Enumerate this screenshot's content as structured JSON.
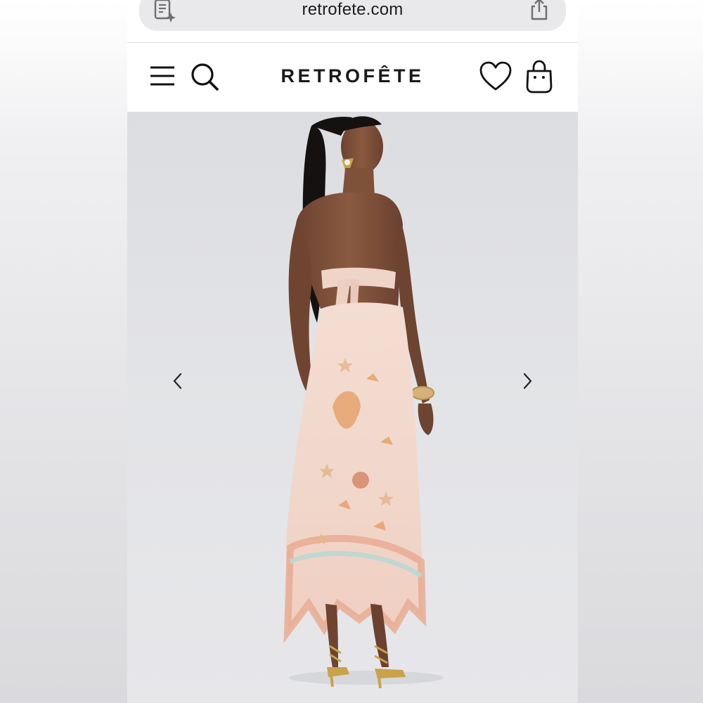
{
  "browser": {
    "url": "retrofete.com",
    "icons": {
      "reader": "reader-page-icon",
      "share": "share-icon"
    }
  },
  "header": {
    "logo": "RETROFÊTE",
    "icons": {
      "menu": "hamburger-menu-icon",
      "search": "search-icon",
      "wishlist": "heart-icon",
      "bag": "shopping-bag-icon"
    }
  },
  "gallery": {
    "prev_icon": "chevron-left-icon",
    "next_icon": "chevron-right-icon",
    "image": "model-in-shell-print-halter-dress-photo"
  },
  "colors": {
    "page_bg": "#ffffff",
    "gallery_bg": "#e0e1e4",
    "urlbar_bg": "#e9e9eb",
    "text": "#1a1a1a"
  }
}
